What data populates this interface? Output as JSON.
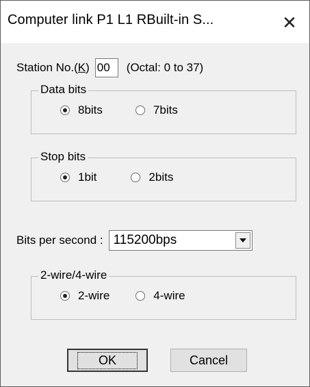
{
  "window": {
    "title": "Computer link  P1 L1 RBuilt-in S...",
    "close_glyph": "✕"
  },
  "station": {
    "label": "Station No.(",
    "accel": "K",
    "label_end": ")",
    "value": "00",
    "range": "(Octal: 0 to 37)"
  },
  "data_bits": {
    "title": "Data bits",
    "options": [
      "8bits",
      "7bits"
    ],
    "selected": "8bits"
  },
  "stop_bits": {
    "title": "Stop bits",
    "options": [
      "1bit",
      "2bits"
    ],
    "selected": "1bit"
  },
  "bps": {
    "label": "Bits per second :",
    "selected": "115200bps"
  },
  "wire": {
    "title": "2-wire/4-wire",
    "options": [
      "2-wire",
      "4-wire"
    ],
    "selected": "2-wire"
  },
  "buttons": {
    "ok": "OK",
    "cancel": "Cancel"
  }
}
